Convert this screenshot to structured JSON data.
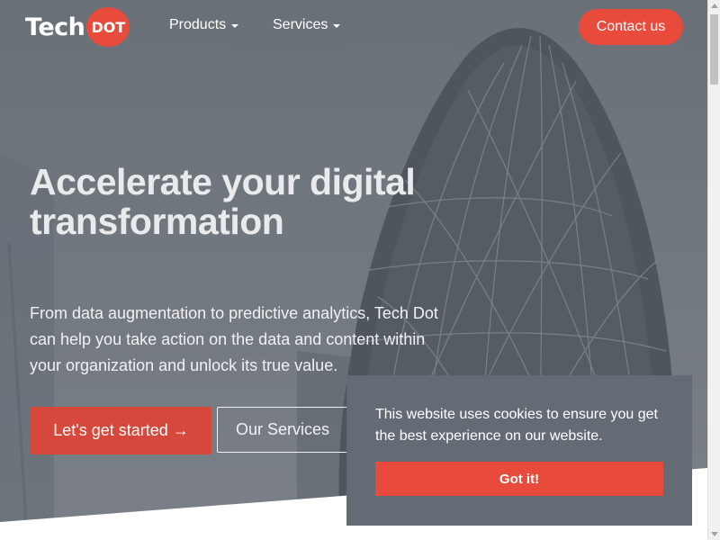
{
  "nav": {
    "logo_word": "Tech",
    "logo_badge": "DOT",
    "items": [
      {
        "label": "Products"
      },
      {
        "label": "Services"
      }
    ],
    "contact_label": "Contact us"
  },
  "hero": {
    "headline": "Accelerate your digital transformation",
    "subtext": "From data augmentation to predictive analytics, Tech Dot can help you take action on the data and content within your organization and unlock its true value.",
    "primary_cta": "Let's get started →",
    "secondary_cta": "Our Services"
  },
  "cookie": {
    "message": "This website uses cookies to ensure you get the best experience on our website.",
    "accept_label": "Got it!"
  },
  "colors": {
    "accent": "#e84a3c",
    "hero_overlay": "#6e747c",
    "cookie_bg": "#646b74"
  }
}
